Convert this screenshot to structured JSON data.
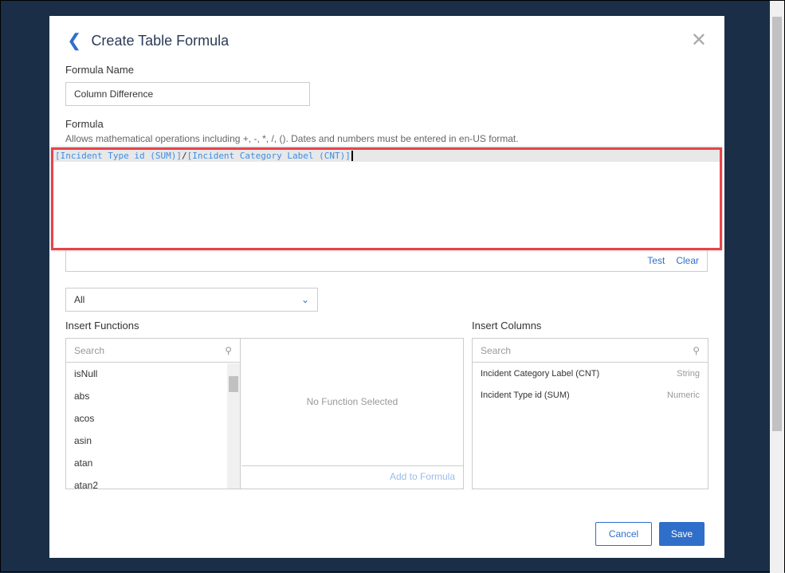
{
  "dialog": {
    "title": "Create Table Formula",
    "formula_name_label": "Formula Name",
    "formula_name_value": "Column Difference",
    "formula_label": "Formula",
    "formula_hint": "Allows mathematical operations including +, -, *, /, (). Dates and numbers must be entered in en-US format.",
    "formula": {
      "part1": "[Incident Type id (SUM)]",
      "operator": "/",
      "part2": "[Incident Category Label (CNT)]"
    },
    "test_label": "Test",
    "clear_label": "Clear",
    "category_select": "All",
    "insert_functions_label": "Insert Functions",
    "insert_columns_label": "Insert Columns",
    "function_search_placeholder": "Search",
    "column_search_placeholder": "Search",
    "functions": [
      "isNull",
      "abs",
      "acos",
      "asin",
      "atan",
      "atan2"
    ],
    "no_function": "No Function Selected",
    "add_to_formula": "Add to Formula",
    "columns": [
      {
        "name": "Incident Category Label (CNT)",
        "type": "String"
      },
      {
        "name": "Incident Type id (SUM)",
        "type": "Numeric"
      }
    ],
    "cancel_label": "Cancel",
    "save_label": "Save"
  }
}
